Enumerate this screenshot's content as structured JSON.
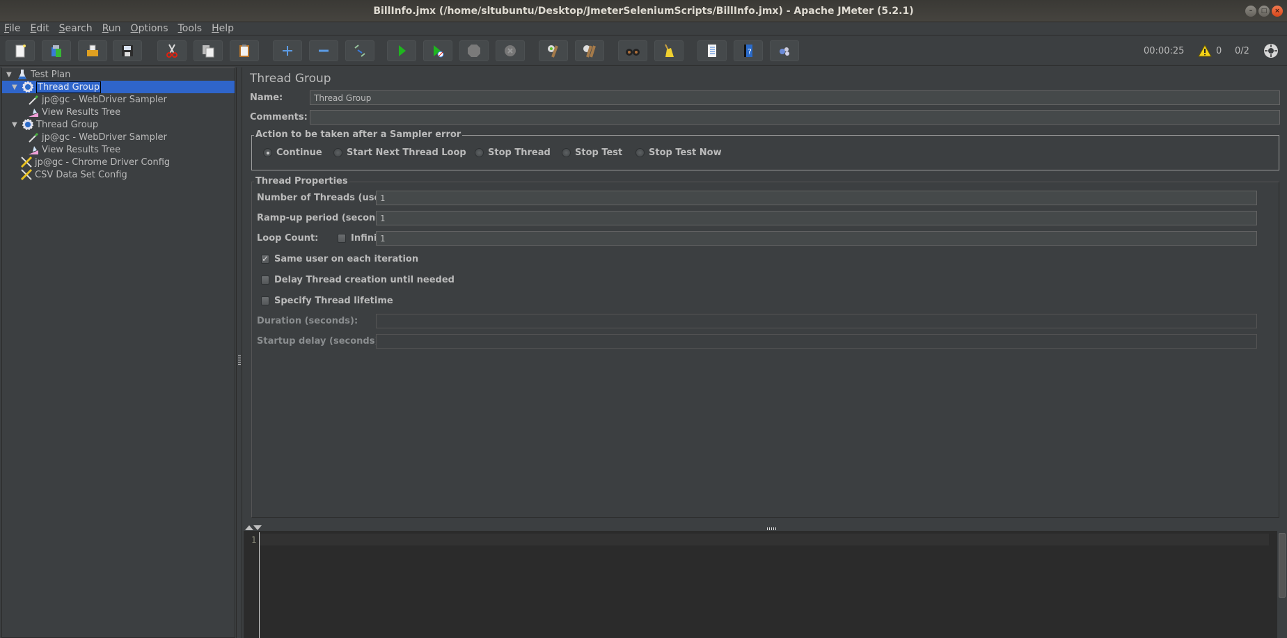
{
  "window": {
    "title": "BillInfo.jmx (/home/sltubuntu/Desktop/JmeterSeleniumScripts/BillInfo.jmx) - Apache JMeter (5.2.1)",
    "controls": {
      "minimize": "–",
      "maximize": "□",
      "close": "×"
    }
  },
  "menu": {
    "items": [
      {
        "label": "File",
        "mnemonic": "F",
        "rest": "ile"
      },
      {
        "label": "Edit",
        "mnemonic": "E",
        "rest": "dit"
      },
      {
        "label": "Search",
        "mnemonic": "S",
        "rest": "earch"
      },
      {
        "label": "Run",
        "mnemonic": "R",
        "rest": "un"
      },
      {
        "label": "Options",
        "mnemonic": "O",
        "rest": "ptions"
      },
      {
        "label": "Tools",
        "mnemonic": "T",
        "rest": "ools"
      },
      {
        "label": "Help",
        "mnemonic": "H",
        "rest": "elp"
      }
    ]
  },
  "toolbar": {
    "buttons": [
      {
        "name": "new",
        "icon": "new-document-icon"
      },
      {
        "name": "templates",
        "icon": "templates-icon"
      },
      {
        "name": "open",
        "icon": "open-folder-icon"
      },
      {
        "name": "save",
        "icon": "save-floppy-icon"
      },
      {
        "name": "cut",
        "icon": "scissors-icon"
      },
      {
        "name": "copy",
        "icon": "copy-icon"
      },
      {
        "name": "paste",
        "icon": "clipboard-icon"
      },
      {
        "name": "expand",
        "icon": "plus-icon"
      },
      {
        "name": "collapse",
        "icon": "minus-icon"
      },
      {
        "name": "toggle",
        "icon": "toggle-icon"
      },
      {
        "name": "start",
        "icon": "play-icon"
      },
      {
        "name": "start-no-pauses",
        "icon": "play-no-timers-icon"
      },
      {
        "name": "stop",
        "icon": "stop-sign-icon"
      },
      {
        "name": "shutdown",
        "icon": "shutdown-icon"
      },
      {
        "name": "clear",
        "icon": "clear-broom-icon"
      },
      {
        "name": "clear-all",
        "icon": "clear-all-broom-icon"
      },
      {
        "name": "search",
        "icon": "binoculars-icon"
      },
      {
        "name": "reset-search",
        "icon": "broom-icon"
      },
      {
        "name": "function-helper",
        "icon": "function-list-icon"
      },
      {
        "name": "help",
        "icon": "help-book-icon"
      },
      {
        "name": "remote",
        "icon": "remote-icon"
      }
    ],
    "status": {
      "elapsed": "00:00:25",
      "warnings": "0",
      "threads": "0/2"
    }
  },
  "tree": {
    "items": [
      {
        "label": "Test Plan",
        "level": 0,
        "icon": "flask-icon",
        "expanded": true
      },
      {
        "label": "Thread Group",
        "level": 1,
        "icon": "gear-icon",
        "expanded": true,
        "selected": true
      },
      {
        "label": "jp@gc - WebDriver Sampler",
        "level": 2,
        "icon": "pipette-icon"
      },
      {
        "label": "View Results Tree",
        "level": 2,
        "icon": "results-tree-icon"
      },
      {
        "label": "Thread Group",
        "level": 1,
        "icon": "gear-icon",
        "expanded": true
      },
      {
        "label": "jp@gc - WebDriver Sampler",
        "level": 2,
        "icon": "pipette-icon"
      },
      {
        "label": "View Results Tree",
        "level": 2,
        "icon": "results-tree-icon"
      },
      {
        "label": "jp@gc - Chrome Driver Config",
        "level": 1,
        "icon": "config-tools-icon"
      },
      {
        "label": "CSV Data Set Config",
        "level": 1,
        "icon": "config-tools-icon"
      }
    ]
  },
  "editor": {
    "title": "Thread Group",
    "name_label": "Name:",
    "name_value": "Thread Group",
    "comments_label": "Comments:",
    "comments_value": "",
    "error_action": {
      "legend": "Action to be taken after a Sampler error",
      "options": [
        {
          "label": "Continue",
          "selected": true
        },
        {
          "label": "Start Next Thread Loop",
          "selected": false
        },
        {
          "label": "Stop Thread",
          "selected": false
        },
        {
          "label": "Stop Test",
          "selected": false
        },
        {
          "label": "Stop Test Now",
          "selected": false
        }
      ]
    },
    "thread_properties": {
      "legend": "Thread Properties",
      "num_threads_label": "Number of Threads (users):",
      "num_threads_value": "1",
      "ramp_up_label": "Ramp-up period (seconds):",
      "ramp_up_value": "1",
      "loop_count_label": "Loop Count:",
      "infinite_label": "Infinite",
      "infinite_checked": false,
      "loop_count_value": "1",
      "same_user_label": "Same user on each iteration",
      "same_user_checked": true,
      "delay_label": "Delay Thread creation until needed",
      "delay_checked": false,
      "lifetime_label": "Specify Thread lifetime",
      "lifetime_checked": false,
      "duration_label": "Duration (seconds):",
      "duration_value": "",
      "startup_delay_label": "Startup delay (seconds):",
      "startup_delay_value": ""
    }
  },
  "log": {
    "line_number": "1",
    "content": ""
  }
}
